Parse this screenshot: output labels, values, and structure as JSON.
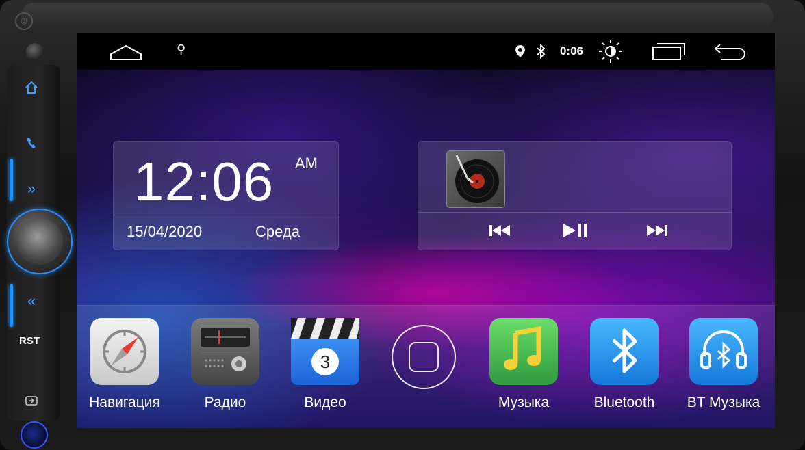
{
  "status_bar": {
    "time": "0:06",
    "icons": [
      "home-outline-icon",
      "usb-icon",
      "location-icon",
      "bluetooth-icon",
      "brightness-icon",
      "recent-apps-icon",
      "back-icon"
    ]
  },
  "left_panel": {
    "rst_label": "RST",
    "buttons": [
      "home-icon",
      "phone-icon",
      "forward-icon",
      "rewind-icon",
      "input-icon"
    ]
  },
  "clock_widget": {
    "time": "12:06",
    "ampm": "AM",
    "date": "15/04/2020",
    "day": "Среда"
  },
  "music_widget": {
    "controls": [
      "previous-icon",
      "play-pause-icon",
      "next-icon"
    ]
  },
  "dock": {
    "apps": [
      {
        "label": "Навигация",
        "icon": "compass-icon"
      },
      {
        "label": "Радио",
        "icon": "radio-icon"
      },
      {
        "label": "Видео",
        "icon": "video-clapper-icon",
        "badge": "3"
      },
      {
        "label": "Музыка",
        "icon": "music-note-icon"
      },
      {
        "label": "Bluetooth",
        "icon": "bluetooth-icon"
      },
      {
        "label": "BT Музыка",
        "icon": "bt-headphones-icon"
      }
    ]
  },
  "colors": {
    "accent_blue": "#1f8fff",
    "statusbar_bg": "#000000"
  }
}
